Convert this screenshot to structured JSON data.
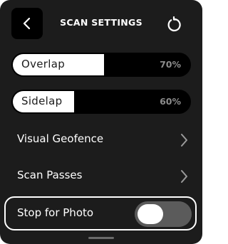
{
  "header": {
    "title": "SCAN SETTINGS",
    "back_icon": "chevron-left-icon",
    "reset_icon": "reset-icon"
  },
  "sliders": [
    {
      "label": "Overlap",
      "value_text": "70%",
      "value": 70
    },
    {
      "label": "Sidelap",
      "value_text": "60%",
      "value": 60
    }
  ],
  "rows": [
    {
      "label": "Visual Geofence",
      "icon": "chevron-right-icon"
    },
    {
      "label": "Scan Passes",
      "icon": "chevron-right-icon"
    }
  ],
  "toggle": {
    "label": "Stop for Photo",
    "state": "off"
  },
  "colors": {
    "panel": "#1c1c1c",
    "track": "#000000",
    "fill": "#ffffff",
    "value_text": "#8c8c8c",
    "toggle_off": "#5b5b5b"
  }
}
